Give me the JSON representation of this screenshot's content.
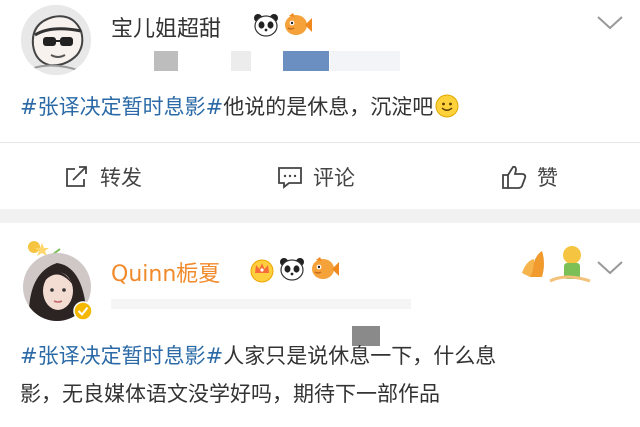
{
  "post1": {
    "username": "宝儿姐超甜",
    "topic": "#张译决定暂时息影#",
    "text": "他说的是休息，沉淀吧",
    "actions": {
      "repost": "转发",
      "comment": "评论",
      "like": "赞"
    }
  },
  "post2": {
    "username": "Quinn栀夏",
    "topic": "#张译决定暂时息影#",
    "text_line1": "人家只是说休息一下，什么息",
    "text_line2": "影，无良媒体语文没学好吗，期待下一部作品"
  },
  "icons": [
    "panda-icon",
    "fish-icon",
    "crown-icon",
    "smiley-icon",
    "chevron-down-icon",
    "repost-icon",
    "comment-icon",
    "like-icon",
    "verified-badge-icon",
    "fox-decoration-icon"
  ],
  "colors": {
    "topic": "#2b6aa6",
    "username2": "#f08a2a",
    "divider": "#f1f1f1"
  }
}
